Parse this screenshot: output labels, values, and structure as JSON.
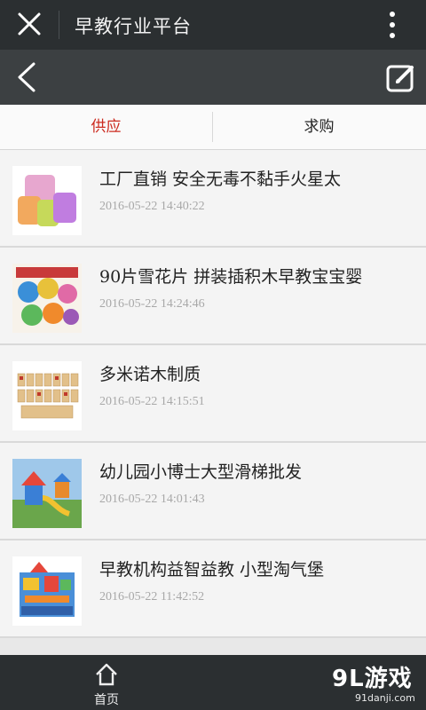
{
  "topbar": {
    "title": "早教行业平台"
  },
  "tabs": [
    {
      "label": "供应",
      "active": true
    },
    {
      "label": "求购",
      "active": false
    }
  ],
  "items": [
    {
      "name": "工厂直销 安全无毒不黏手火星太",
      "time": "2016-05-22 14:40:22",
      "icon": "slime-buckets-thumbnail"
    },
    {
      "name": "90片雪花片 拼装插积木早教宝宝婴",
      "time": "2016-05-22 14:24:46",
      "icon": "snowflake-blocks-thumbnail"
    },
    {
      "name": "多米诺木制质",
      "time": "2016-05-22 14:15:51",
      "icon": "domino-thumbnail"
    },
    {
      "name": "幼儿园小博士大型滑梯批发",
      "time": "2016-05-22 14:01:43",
      "icon": "slide-thumbnail"
    },
    {
      "name": "早教机构益智益教 小型淘气堡",
      "time": "2016-05-22 11:42:52",
      "icon": "playground-thumbnail"
    }
  ],
  "bottombar": {
    "home_label": "首页"
  },
  "watermark": {
    "brand": "9L游戏",
    "domain": "91danji.com"
  },
  "colors": {
    "accent": "#cc2b20",
    "topbar": "#2b2f31",
    "navbar": "#3c4042"
  }
}
